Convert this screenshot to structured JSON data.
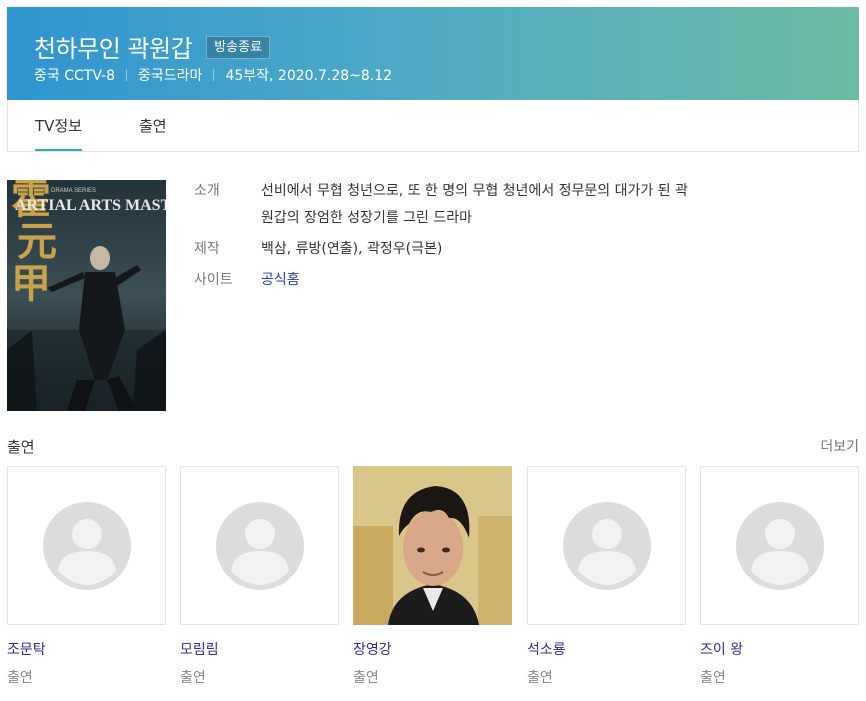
{
  "header": {
    "title": "천하무인 곽원갑",
    "badge": "방송종료",
    "meta": [
      "중국 CCTV-8",
      "중국드라마",
      "45부작, 2020.7.28~8.12"
    ]
  },
  "tabs": [
    "TV정보",
    "출연"
  ],
  "poster": {
    "text_main": "ARTIAL ARTS MASTER",
    "text_small": "DRAMA SERIES"
  },
  "info": {
    "synopsis_label": "소개",
    "synopsis_line1": "선비에서 무협 청년으로, 또 한 명의 무협 청년에서 정무문의 대가가 된 곽",
    "synopsis_line2": "원갑의 장엄한 성장기를 그린 드라마",
    "production_label": "제작",
    "production_value": "백삼, 류방(연출), 곽정우(극본)",
    "site_label": "사이트",
    "site_value": "공식홈"
  },
  "cast": {
    "title": "출연",
    "more": "더보기",
    "members": [
      {
        "name": "조문탁",
        "role": "출연",
        "photo": "placeholder"
      },
      {
        "name": "모림림",
        "role": "출연",
        "photo": "placeholder"
      },
      {
        "name": "장영강",
        "role": "출연",
        "photo": "actor"
      },
      {
        "name": "석소룡",
        "role": "출연",
        "photo": "placeholder"
      },
      {
        "name": "즈이 왕",
        "role": "출연",
        "photo": "placeholder"
      }
    ]
  }
}
